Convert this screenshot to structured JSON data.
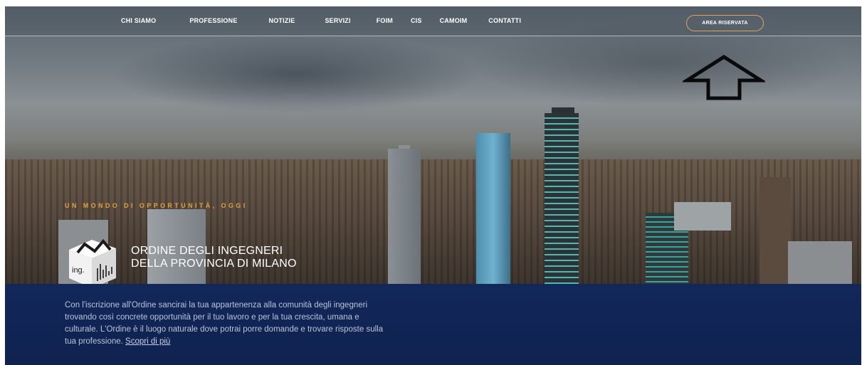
{
  "nav": {
    "items": [
      {
        "label": "CHI SIAMO"
      },
      {
        "label": "PROFESSIONE"
      },
      {
        "label": "NOTIZIE"
      },
      {
        "label": "SERVIZI"
      },
      {
        "label": "FOIM"
      },
      {
        "label": "CIS"
      },
      {
        "label": "CAMOIM"
      },
      {
        "label": "CONTATTI"
      }
    ],
    "reserved_area_label": "AREA RISERVATA"
  },
  "hero": {
    "tagline": "UN MONDO DI OPPORTUNITÀ, OGGI",
    "logo_text": "ing.",
    "org_name_line1": "ORDINE DEGLI INGEGNERI",
    "org_name_line2": "DELLA PROVINCIA DI MILANO"
  },
  "intro": {
    "text": "Con l'iscrizione all'Ordine sancirai la tua appartenenza alla comunità degli ingegneri trovando così concrete opportunità per il tuo lavoro e per la tua crescita, umana e culturale. L'Ordine è il luogo naturale dove potrai porre domande e trovare risposte sulla tua professione.",
    "link_label": "Scopri di più"
  },
  "colors": {
    "accent": "#e0a13a",
    "button_border": "#d9a25f",
    "intro_bg": "#12285a"
  }
}
